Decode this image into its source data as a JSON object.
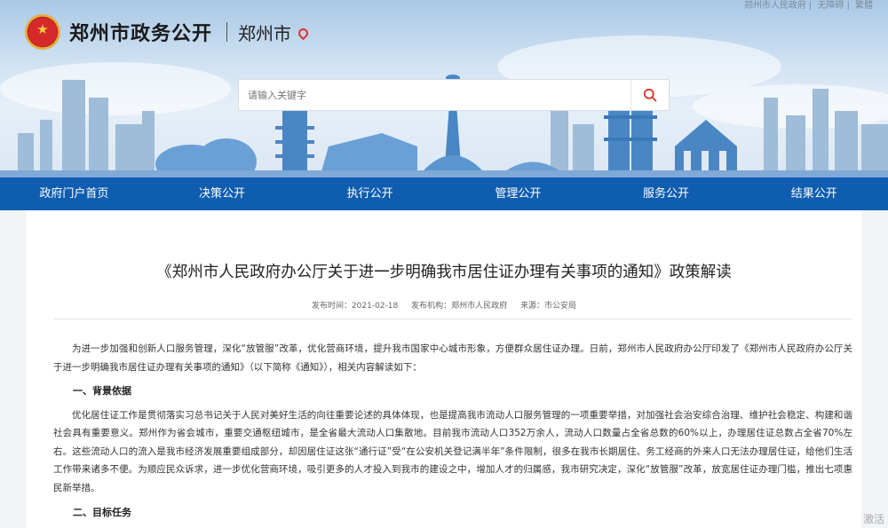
{
  "header": {
    "top_links": [
      "郑州市人民政府",
      "无障碍",
      "繁體"
    ],
    "site_title": "郑州市政务公开",
    "city": "郑州市"
  },
  "search": {
    "placeholder": "请输入关键字"
  },
  "nav": [
    "政府门户首页",
    "决策公开",
    "执行公开",
    "管理公开",
    "服务公开",
    "结果公开"
  ],
  "article": {
    "title": "《郑州市人民政府办公厅关于进一步明确我市居住证办理有关事项的通知》政策解读",
    "publish_time": "发布时间：2021-02-18",
    "publisher": "发布机构：郑州市人民政府",
    "source": "来源：市公安局",
    "intro": "为进一步加强和创新人口服务管理，深化“放管服”改革，优化营商环境，提升我市国家中心城市形象，方便群众居住证办理。日前，郑州市人民政府办公厅印发了《郑州市人民政府办公厅关于进一步明确我市居住证办理有关事项的通知》（以下简称《通知》），相关内容解读如下：",
    "section1_title": "一、背景依据",
    "section1_body": "优化居住证工作是贯彻落实习总书记关于人民对美好生活的向往重要论述的具体体现，也是提高我市流动人口服务管理的一项重要举措，对加强社会治安综合治理、维护社会稳定、构建和谐社会具有重要意义。郑州作为省会城市，重要交通枢纽城市，是全省最大流动人口集散地。目前我市流动人口352万余人，流动人口数量占全省总数的60%以上，办理居住证总数占全省70%左右。这些流动人口的流入是我市经济发展重要组成部分，却因居住证这张“通行证”受“在公安机关登记满半年”条件限制，很多在我市长期居住、务工经商的外来人口无法办理居住证，给他们生活工作带来诸多不便。为顺应民众诉求，进一步优化营商环境，吸引更多的人才投入到我市的建设之中，增加人才的归属感，我市研究决定，深化“放管服”改革，放宽居住证办理门槛，推出七项惠民新举措。",
    "section2_title": "二、目标任务"
  },
  "watermark": "激活"
}
